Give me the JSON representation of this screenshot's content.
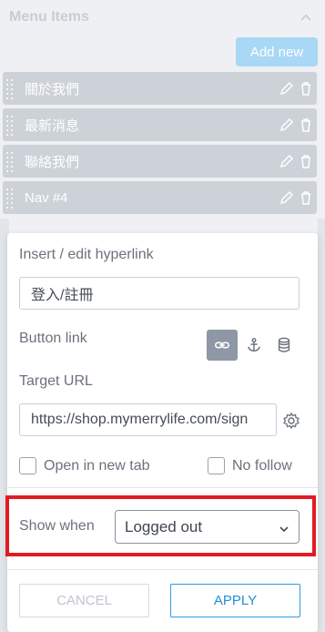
{
  "menu": {
    "header": "Menu Items",
    "add_new_label": "Add new",
    "items": [
      {
        "label": "關於我們"
      },
      {
        "label": "最新消息"
      },
      {
        "label": "聯絡我們"
      },
      {
        "label": "Nav #4"
      }
    ]
  },
  "popup": {
    "title": "Insert / edit hyperlink",
    "link_text": "登入/註冊",
    "button_link_label": "Button link",
    "link_types": [
      "link-icon",
      "anchor-icon",
      "database-icon"
    ],
    "target_url_label": "Target URL",
    "target_url_value": "https://shop.mymerrylife.com/sign",
    "open_new_tab_label": "Open in new tab",
    "no_follow_label": "No follow",
    "show_when_label": "Show when",
    "show_when_value": "Logged out",
    "cancel_label": "CANCEL",
    "apply_label": "APPLY"
  },
  "colors": {
    "accent": "#1f8fd8",
    "highlight": "#e11b24",
    "add_button": "#a8d8f5",
    "menu_row": "#cdd2d9"
  }
}
